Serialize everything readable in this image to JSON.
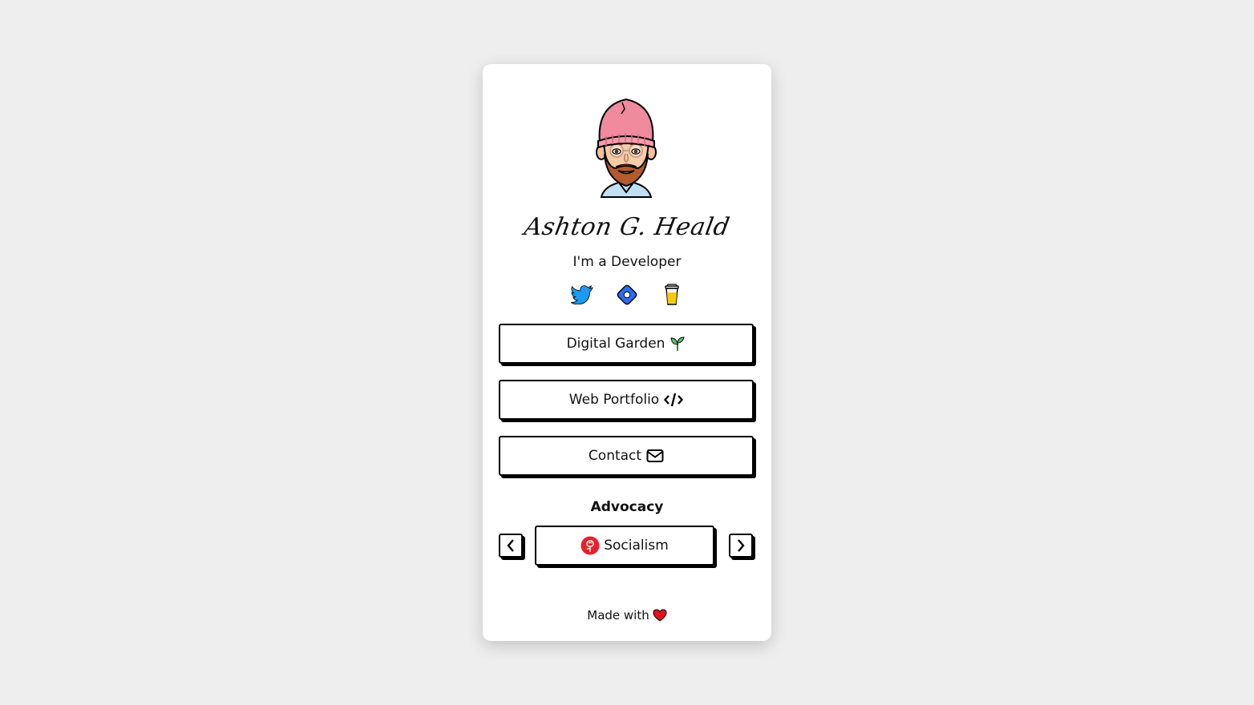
{
  "profile": {
    "name": "Ashton G. Heald",
    "tagline": "I'm a Developer"
  },
  "socials": [
    {
      "icon": "twitter-bird-icon"
    },
    {
      "icon": "diamond-badge-icon"
    },
    {
      "icon": "coffee-cup-icon"
    }
  ],
  "links": [
    {
      "label": "Digital Garden",
      "icon": "seedling-icon"
    },
    {
      "label": "Web Portfolio",
      "icon": "code-icon"
    },
    {
      "label": "Contact",
      "icon": "envelope-icon"
    }
  ],
  "advocacy": {
    "title": "Advocacy",
    "current": {
      "label": "Socialism",
      "icon": "rose-icon"
    },
    "prev_icon": "chevron-left-icon",
    "next_icon": "chevron-right-icon"
  },
  "footer": {
    "text": "Made with",
    "icon": "heart-icon"
  },
  "colors": {
    "background": "#eeeeee",
    "card": "#ffffff",
    "border": "#000000",
    "twitter": "#1d9bf0",
    "badge": "#2b6cf0",
    "heart": "#e0111b",
    "rose": "#e8202a"
  }
}
